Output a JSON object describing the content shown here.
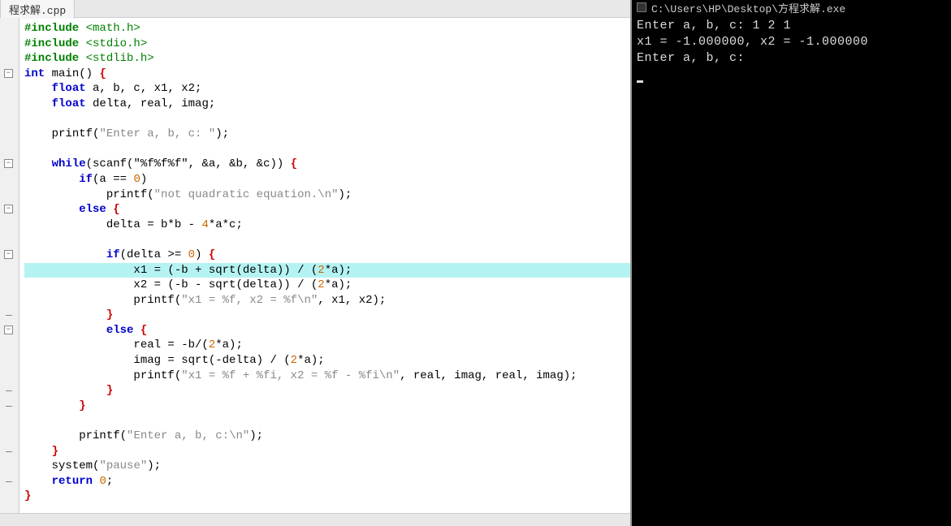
{
  "tab": {
    "label": "程求解.cpp"
  },
  "code": {
    "lines": [
      {
        "type": "pp",
        "text": "#include <math.h>"
      },
      {
        "type": "pp",
        "text": "#include <stdio.h>"
      },
      {
        "type": "pp",
        "text": "#include <stdlib.h>"
      },
      {
        "type": "main",
        "text": "int main() {"
      },
      {
        "type": "decl",
        "indent": 1,
        "text": "float a, b, c, x1, x2;"
      },
      {
        "type": "decl",
        "indent": 1,
        "text": "float delta, real, imag;"
      },
      {
        "type": "blank"
      },
      {
        "type": "printf",
        "indent": 1,
        "fn": "printf",
        "str": "\"Enter a, b, c: \"",
        "tail": ");"
      },
      {
        "type": "blank"
      },
      {
        "type": "while",
        "indent": 1,
        "text": "while(scanf(\"%f%f%f\", &a, &b, &c)) {"
      },
      {
        "type": "if",
        "indent": 2,
        "text": "if(a == 0)"
      },
      {
        "type": "printf",
        "indent": 3,
        "fn": "printf",
        "str": "\"not quadratic equation.\\n\"",
        "tail": ");"
      },
      {
        "type": "else",
        "indent": 2,
        "text": "else {"
      },
      {
        "type": "stmt",
        "indent": 3,
        "text": "delta = b*b - 4*a*c;"
      },
      {
        "type": "blank"
      },
      {
        "type": "if",
        "indent": 3,
        "text": "if(delta >= 0) {"
      },
      {
        "type": "stmt",
        "indent": 4,
        "hl": true,
        "text": "x1 = (-b + sqrt(delta)) / (2*a);"
      },
      {
        "type": "stmt",
        "indent": 4,
        "text": "x2 = (-b - sqrt(delta)) / (2*a);"
      },
      {
        "type": "printf",
        "indent": 4,
        "fn": "printf",
        "str": "\"x1 = %f, x2 = %f\\n\"",
        "tail": ", x1, x2);"
      },
      {
        "type": "close",
        "indent": 3,
        "text": "}"
      },
      {
        "type": "else",
        "indent": 3,
        "text": "else {"
      },
      {
        "type": "stmt",
        "indent": 4,
        "text": "real = -b/(2*a);"
      },
      {
        "type": "stmt",
        "indent": 4,
        "text": "imag = sqrt(-delta) / (2*a);"
      },
      {
        "type": "printf",
        "indent": 4,
        "fn": "printf",
        "str": "\"x1 = %f + %fi, x2 = %f - %fi\\n\"",
        "tail": ", real, imag, real, imag);"
      },
      {
        "type": "close",
        "indent": 3,
        "text": "}"
      },
      {
        "type": "close",
        "indent": 2,
        "text": "}"
      },
      {
        "type": "blank"
      },
      {
        "type": "printf",
        "indent": 2,
        "fn": "printf",
        "str": "\"Enter a, b, c:\\n\"",
        "tail": ");"
      },
      {
        "type": "close",
        "indent": 1,
        "text": "}"
      },
      {
        "type": "call",
        "indent": 1,
        "fn": "system",
        "str": "\"pause\"",
        "tail": ");"
      },
      {
        "type": "return",
        "indent": 1,
        "text": "return 0;"
      },
      {
        "type": "close",
        "indent": 0,
        "text": "}"
      }
    ]
  },
  "folds": [
    {
      "line": 3,
      "sym": "−"
    },
    {
      "line": 9,
      "sym": "−"
    },
    {
      "line": 12,
      "sym": "−"
    },
    {
      "line": 15,
      "sym": "−"
    },
    {
      "line": 20,
      "sym": "−"
    }
  ],
  "ticks": [
    19,
    24,
    25,
    28,
    30
  ],
  "console": {
    "title": "C:\\Users\\HP\\Desktop\\方程求解.exe",
    "lines": [
      "Enter a, b, c: 1 2 1",
      "x1 = -1.000000, x2 = -1.000000",
      "Enter a, b, c:"
    ]
  }
}
